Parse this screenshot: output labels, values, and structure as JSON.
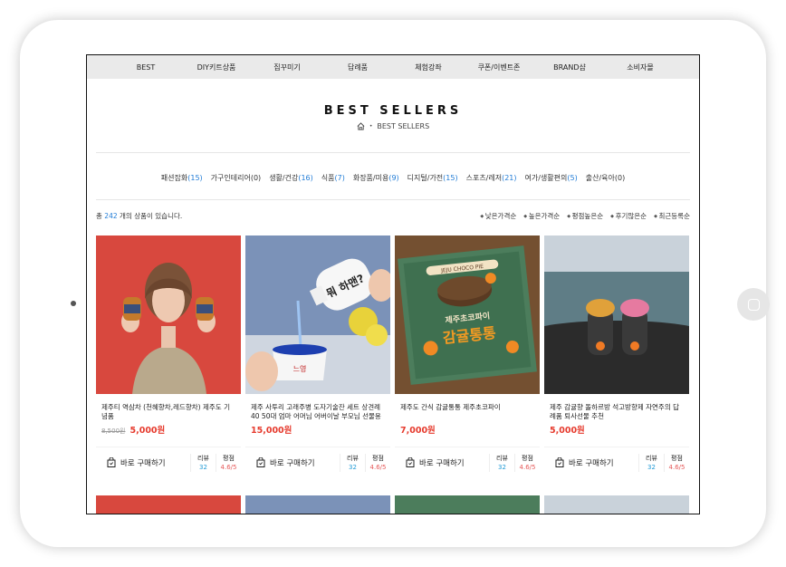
{
  "nav": [
    "BEST",
    "DIY키트상품",
    "집꾸미기",
    "답례품",
    "체험강좌",
    "쿠폰/이벤트존",
    "BRAND샵",
    "소비자몰"
  ],
  "hero": {
    "title": "BEST SELLERS",
    "breadcrumb": "BEST SELLERS"
  },
  "categories": [
    {
      "name": "패션잡화",
      "count": "(15)"
    },
    {
      "name": "가구인테리어",
      "count": "(0)"
    },
    {
      "name": "생활/건강",
      "count": "(16)"
    },
    {
      "name": "식품",
      "count": "(7)"
    },
    {
      "name": "화장품/미용",
      "count": "(9)"
    },
    {
      "name": "디지털/가전",
      "count": "(15)"
    },
    {
      "name": "스포츠/레저",
      "count": "(21)"
    },
    {
      "name": "여가/생활편의",
      "count": "(5)"
    },
    {
      "name": "출산/육아",
      "count": "(0)"
    }
  ],
  "listing": {
    "total_prefix": "총 ",
    "total_count": "242",
    "total_suffix": " 개의 상품이 있습니다.",
    "sorts": [
      "낮은가격순",
      "높은가격순",
      "평점높은순",
      "후기많은순",
      "최근등록순"
    ]
  },
  "products": [
    {
      "name": "제주티 역삼차 (천혜향차,레드향차) 제주도 기념품",
      "orig_price": "8,500원",
      "price": "5,000원",
      "buy_label": "바로 구매하기",
      "review_label": "리뷰",
      "review_count": "32",
      "rating_label": "평점",
      "rating": "4.6/5"
    },
    {
      "name": "제주 사투리 고래주병 도자기술잔 세트 상견례 40 50대 엄마 어머님 어버이날 부모님 선물용 도자...",
      "orig_price": "",
      "price": "15,000원",
      "buy_label": "바로 구매하기",
      "review_label": "리뷰",
      "review_count": "32",
      "rating_label": "평점",
      "rating": "4.6/5"
    },
    {
      "name": "제주도 간식 감귤통통 제주초코파이",
      "orig_price": "",
      "price": "7,000원",
      "buy_label": "바로 구매하기",
      "review_label": "리뷰",
      "review_count": "32",
      "rating_label": "평점",
      "rating": "4.6/5"
    },
    {
      "name": "제주 감귤향 돌하르방 석고방향제 자연주의 답례품 퇴사선물 추천",
      "orig_price": "",
      "price": "5,000원",
      "buy_label": "바로 구매하기",
      "review_label": "리뷰",
      "review_count": "32",
      "rating_label": "평점",
      "rating": "4.6/5"
    }
  ],
  "image_text": {
    "bottle": "뭐 하맨?",
    "cup": "느영",
    "box_brand": "JEJU CHOCO PIE",
    "box_sub": "제주초코파이",
    "box_title": "감귤통통"
  },
  "colors": {
    "accent_blue": "#1f7bd6",
    "price_red": "#e63b2e",
    "nav_bg": "#eaeaea"
  }
}
